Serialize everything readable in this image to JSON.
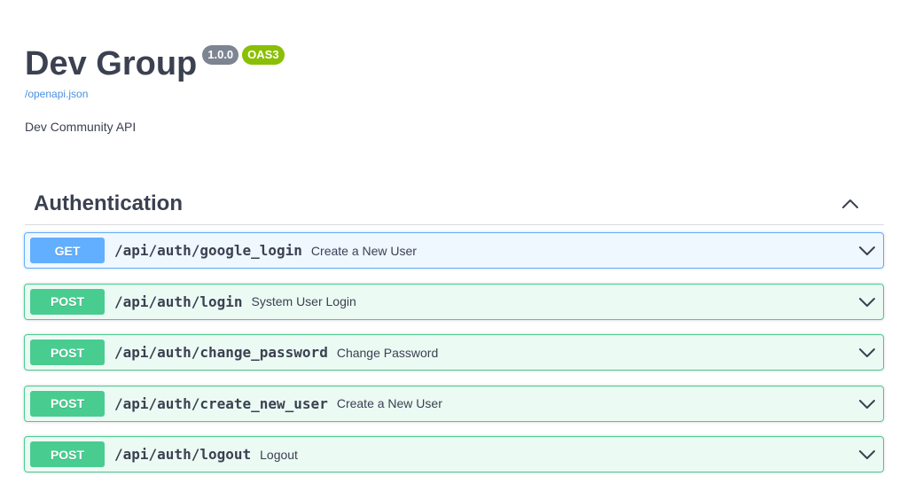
{
  "info": {
    "title": "Dev Group",
    "version": "1.0.0",
    "oas": "OAS3",
    "spec_link": "/openapi.json",
    "description": "Dev Community API"
  },
  "tag": {
    "name": "Authentication",
    "toggle_icon": "chevron-up-icon"
  },
  "operations": [
    {
      "method": "GET",
      "path": "/api/auth/google_login",
      "summary": "Create a New User"
    },
    {
      "method": "POST",
      "path": "/api/auth/login",
      "summary": "System User Login"
    },
    {
      "method": "POST",
      "path": "/api/auth/change_password",
      "summary": "Change Password"
    },
    {
      "method": "POST",
      "path": "/api/auth/create_new_user",
      "summary": "Create a New User"
    },
    {
      "method": "POST",
      "path": "/api/auth/logout",
      "summary": "Logout"
    }
  ],
  "colors": {
    "get": "#61affe",
    "post": "#49cc90",
    "version_badge": "#7d8492",
    "oas_badge": "#89bf04",
    "link": "#4990e2",
    "text": "#3b4151"
  }
}
